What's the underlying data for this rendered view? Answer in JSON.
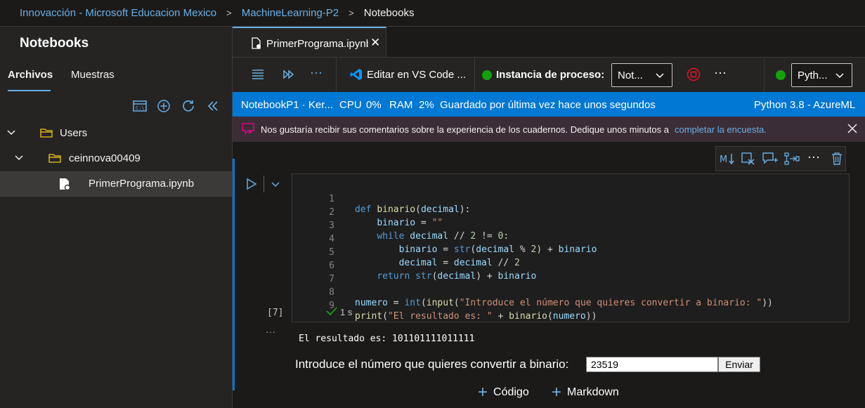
{
  "breadcrumb": {
    "workspace": "Innovacción - Microsoft Educacion Mexico",
    "project": "MachineLearning-P2",
    "current": "Notebooks",
    "separator": ">"
  },
  "sidebar": {
    "title": "Notebooks",
    "tabs": [
      "Archivos",
      "Muestras"
    ],
    "tree": [
      {
        "label": "Users"
      },
      {
        "label": "ceinnova00409"
      },
      {
        "label": "PrimerPrograma.ipynb"
      }
    ]
  },
  "editor": {
    "tab_label": "PrimerPrograma.ipynb",
    "close_glyph": "✕"
  },
  "toolbar": {
    "edit_vscode": "Editar en VS Code ...",
    "compute_label": "Instancia de proceso:",
    "compute_value": "Not...",
    "kernel_value": "Pyth...",
    "more": "···"
  },
  "status": {
    "notebook": "NotebookP1 · Ker...",
    "cpu_label": "CPU",
    "cpu_value": "0%",
    "ram_label": "RAM",
    "ram_value": "2%",
    "saved": "Guardado por última vez hace unos segundos",
    "kernel": "Python 3.8 - AzureML"
  },
  "feedback": {
    "message": "Nos gustaría recibir sus comentarios sobre la experiencia de los cuadernos. Dedique unos minutos a",
    "link": "completar la encuesta."
  },
  "cell": {
    "exec_count": "[7]",
    "duration": "1 s",
    "more": "···",
    "code_lines": [
      {
        "n": "1",
        "text": "def binario(decimal):"
      },
      {
        "n": "2",
        "text": "    binario = \"\""
      },
      {
        "n": "3",
        "text": "    while decimal // 2 != 0:"
      },
      {
        "n": "4",
        "text": "        binario = str(decimal % 2) + binario"
      },
      {
        "n": "5",
        "text": "        decimal = decimal // 2"
      },
      {
        "n": "6",
        "text": "    return str(decimal) + binario"
      },
      {
        "n": "7",
        "text": ""
      },
      {
        "n": "8",
        "text": "numero = int(input(\"Introduce el número que quieres convertir a binario: \"))"
      },
      {
        "n": "9",
        "text": "print(\"El resultado es: \" + binario(numero))"
      }
    ],
    "output": "El resultado es: 101101111011111",
    "prompt_label": "Introduce el número que quieres convertir a binario:",
    "prompt_value": "23519",
    "submit_label": "Enviar"
  },
  "add_cell": {
    "code": "Código",
    "markdown": "Markdown"
  },
  "colors": {
    "accent": "#0078d4",
    "link": "#69afe5",
    "running": "#13a10e",
    "stop": "#e81123"
  }
}
